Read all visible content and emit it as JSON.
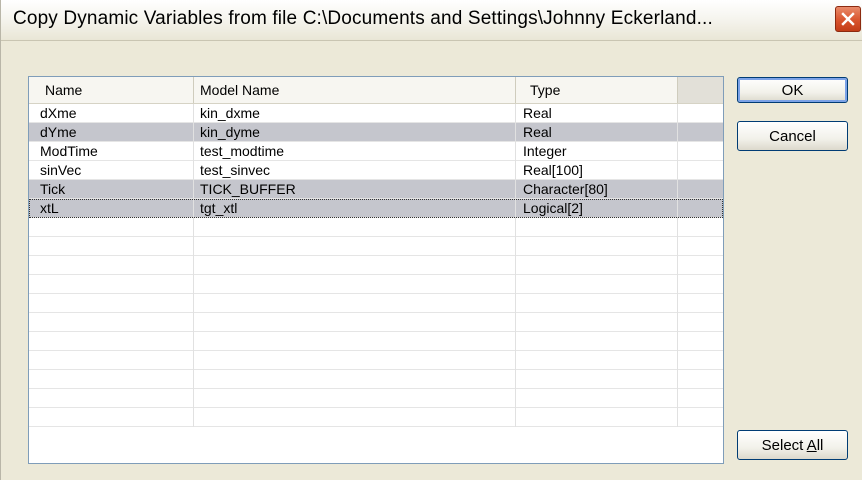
{
  "window": {
    "title": "Copy Dynamic Variables from file C:\\Documents and Settings\\Johnny Eckerland...",
    "accent_color": "#0054E3",
    "close_color": "#D9542E"
  },
  "table": {
    "columns": [
      "Name",
      "Model Name",
      "Type"
    ],
    "rows": [
      {
        "name": "dXme",
        "model_name": "kin_dxme",
        "type": "Real",
        "selected": false
      },
      {
        "name": "dYme",
        "model_name": "kin_dyme",
        "type": "Real",
        "selected": true
      },
      {
        "name": "ModTime",
        "model_name": "test_modtime",
        "type": "Integer",
        "selected": false
      },
      {
        "name": "sinVec",
        "model_name": "test_sinvec",
        "type": "Real[100]",
        "selected": false
      },
      {
        "name": "Tick",
        "model_name": "TICK_BUFFER",
        "type": "Character[80]",
        "selected": true
      },
      {
        "name": "xtL",
        "model_name": "tgt_xtl",
        "type": "Logical[2]",
        "selected": true
      }
    ],
    "empty_rows": 11
  },
  "buttons": {
    "ok": "OK",
    "cancel": "Cancel",
    "select_all_prefix": "Select ",
    "select_all_accel": "A",
    "select_all_suffix": "ll"
  }
}
